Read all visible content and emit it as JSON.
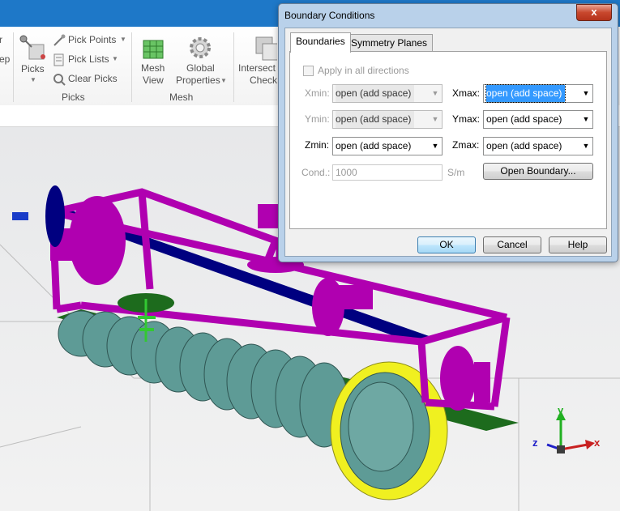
{
  "ribbon": {
    "left_partial_1": "r",
    "left_partial_2": "ep",
    "picks_label": "Picks",
    "pick_points": "Pick Points",
    "pick_lists": "Pick Lists",
    "clear_picks": "Clear Picks",
    "group_picks": "Picks",
    "mesh_view_1": "Mesh",
    "mesh_view_2": "View",
    "global_props_1": "Global",
    "global_props_2": "Properties",
    "group_mesh": "Mesh",
    "intersect_1": "Intersect",
    "intersect_2": "Check"
  },
  "dialog": {
    "title": "Boundary Conditions",
    "close": "x",
    "tabs": [
      "Boundaries",
      "Symmetry Planes"
    ],
    "apply_all": "Apply in all directions",
    "xmin_label": "Xmin:",
    "xmin_value": "open (add space)",
    "xmax_label": "Xmax:",
    "xmax_value": "open (add space)",
    "ymin_label": "Ymin:",
    "ymin_value": "open (add space)",
    "ymax_label": "Ymax:",
    "ymax_value": "open (add space)",
    "zmin_label": "Zmin:",
    "zmin_value": "open (add space)",
    "zmax_label": "Zmax:",
    "zmax_value": "open (add space)",
    "cond_label": "Cond.:",
    "cond_value": "1000",
    "cond_unit": "S/m",
    "open_boundary": "Open Boundary...",
    "ok": "OK",
    "cancel": "Cancel",
    "help": "Help"
  },
  "axes": {
    "x": "x",
    "y": "y",
    "z": "z"
  },
  "colors": {
    "frame": "#b000b0",
    "shaft": "#000080",
    "plate": "#1d6b1d",
    "helix": "#5e9b96",
    "ring": "#f0f020",
    "title_bar": "#1e78c8"
  }
}
